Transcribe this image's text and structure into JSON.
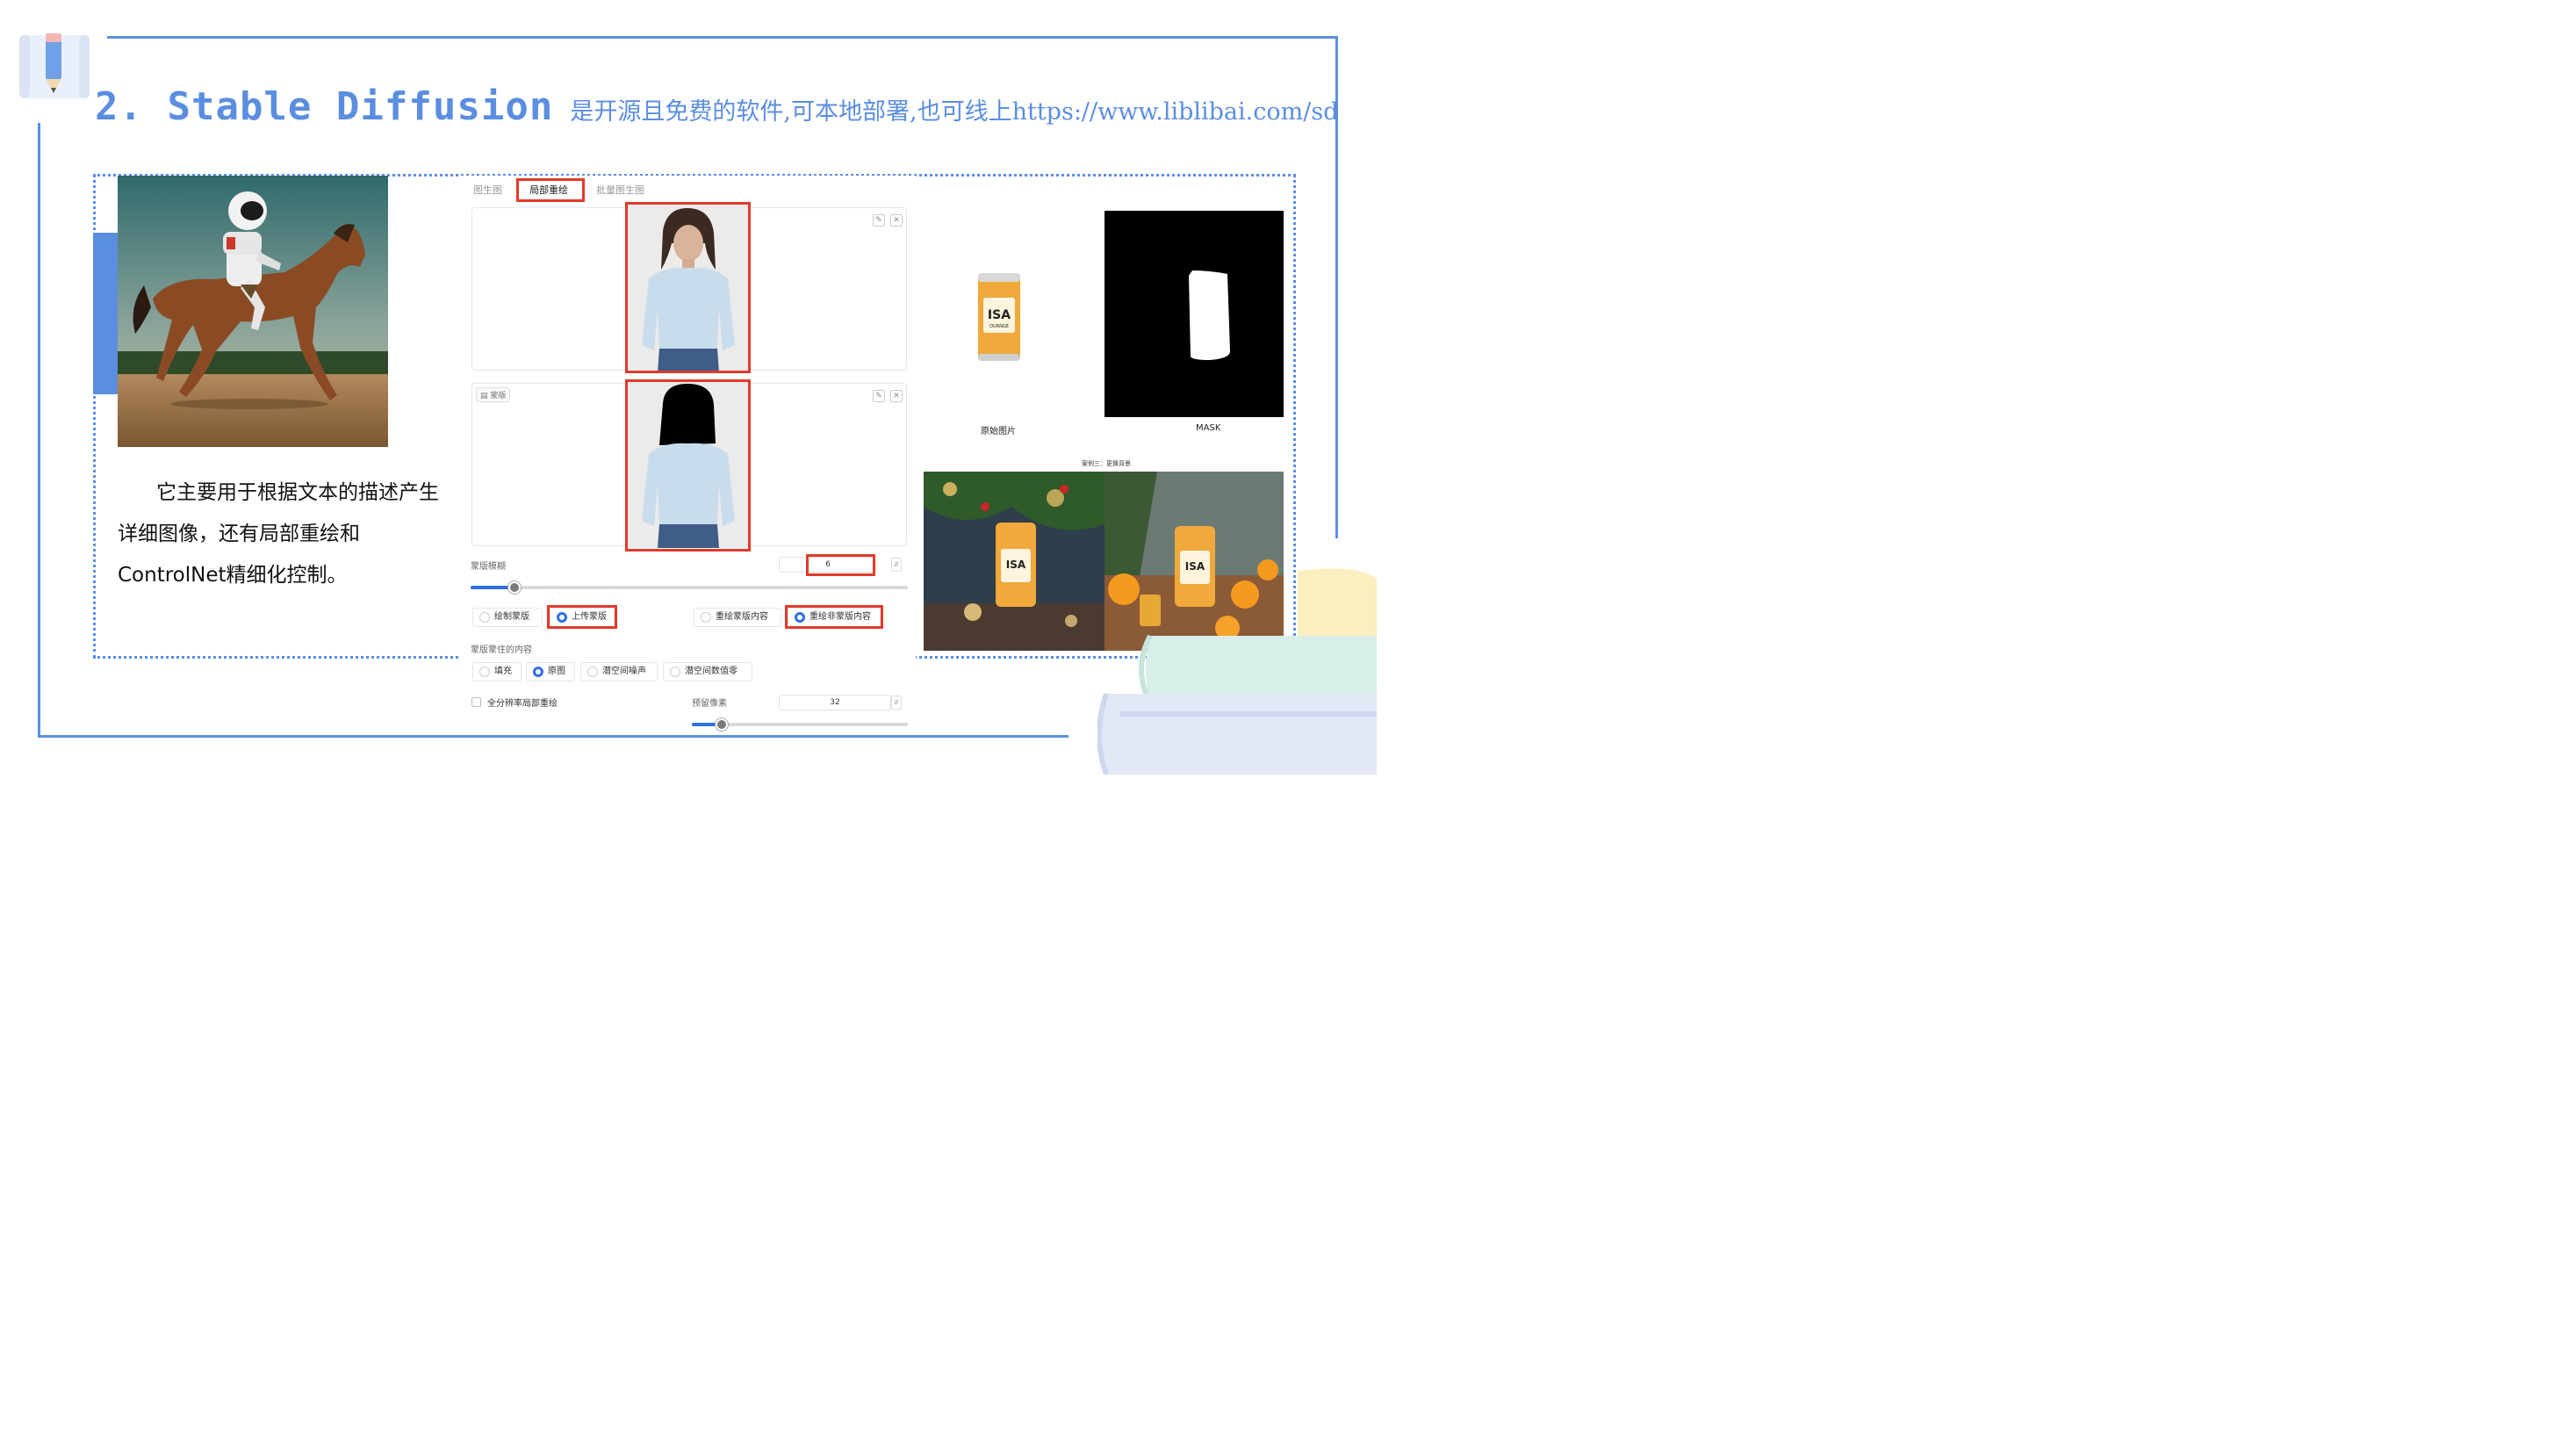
{
  "title": {
    "main": "2. Stable Diffusion",
    "subtitle": "是开源且免费的软件,可本地部署,也可线上https://www.liblibai.com/sd"
  },
  "description": {
    "line_1": "它主要用于根据文本的描述产生详细图像，还有局部重绘和ControlNet精细化控制。"
  },
  "sd_panel": {
    "tabs": [
      "图生图",
      "局部重绘",
      "批量图生图"
    ],
    "active_tab": "局部重绘",
    "mask_chip": "蒙版",
    "edit_icon": "pencil-icon",
    "close_icon": "close-icon",
    "mask_blur_label": "蒙版模糊",
    "mask_blur_value": "6",
    "mask_blur_fraction": 0.1,
    "mask_mode_options": [
      "绘制蒙版",
      "上传蒙版"
    ],
    "mask_mode_selected": "上传蒙版",
    "inpaint_target_options": [
      "重绘蒙版内容",
      "重绘非蒙版内容"
    ],
    "inpaint_target_selected": "重绘非蒙版内容",
    "masked_content_label": "蒙版蒙住的内容",
    "masked_content_options": [
      "填充",
      "原图",
      "潜空间噪声",
      "潜空间数值零"
    ],
    "masked_content_selected": "原图",
    "full_res_label": "全分辨率局部重绘",
    "padding_label": "预留像素",
    "padding_value": "32",
    "padding_fraction": 0.14,
    "accent_color": "#2f6fe4",
    "highlight_color": "#e23a2a"
  },
  "product_example": {
    "original_caption": "原始图片",
    "mask_caption": "MASK",
    "example_title": "案例三：更换背景",
    "can_label_brand": "ISA",
    "can_label_line": "OURNGE"
  },
  "colors": {
    "theme_blue": "#5b8ee0"
  }
}
